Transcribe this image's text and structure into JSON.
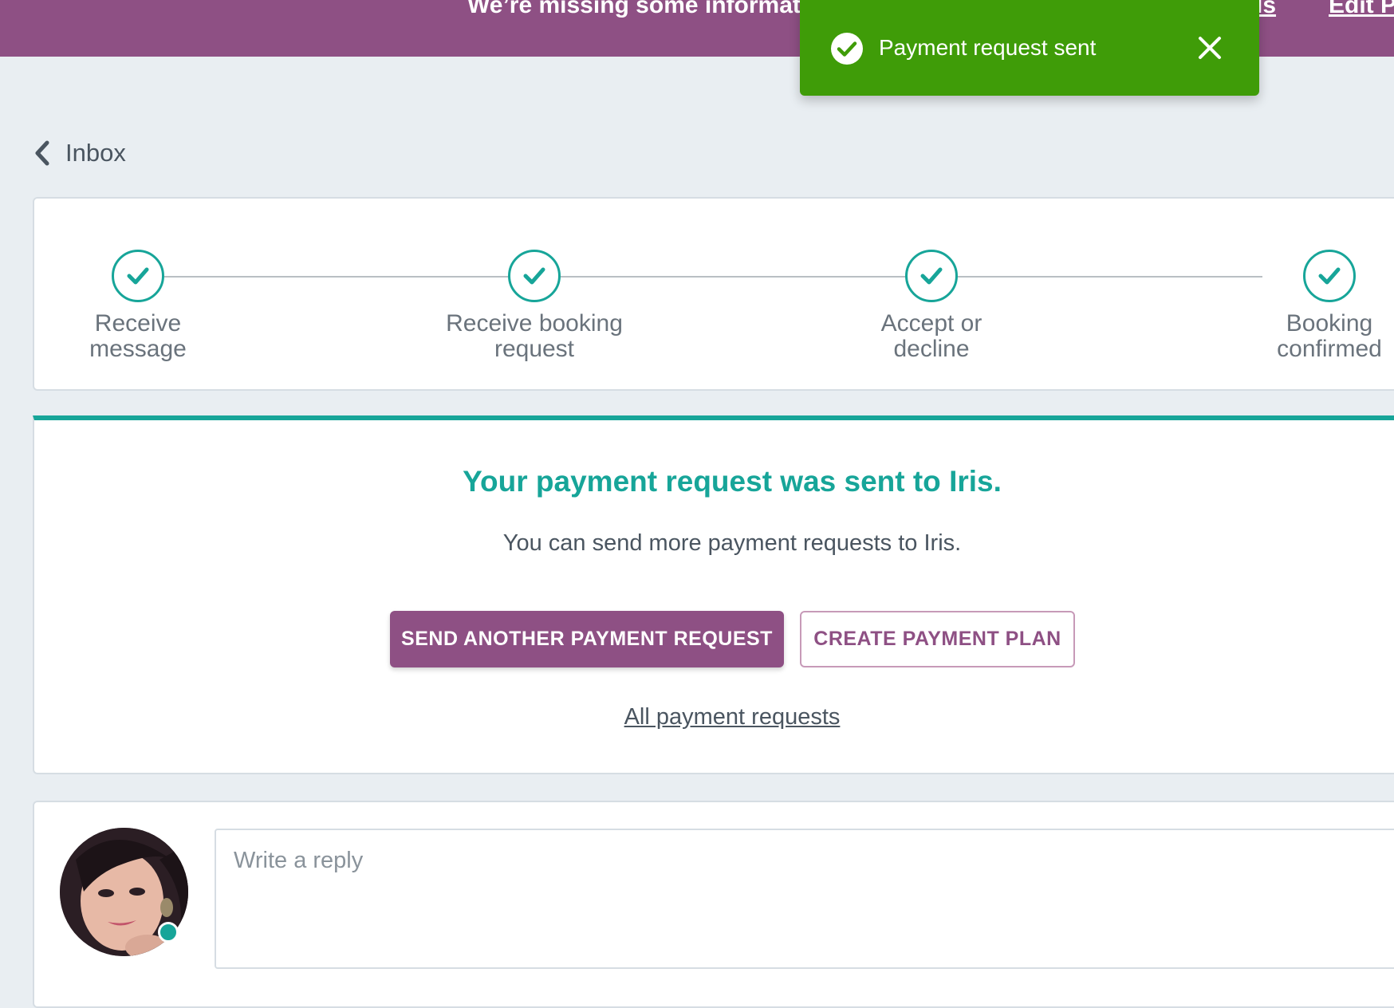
{
  "banner": {
    "text": "We’re missing some informatio",
    "link_details": "tails",
    "link_edit": "Edit P"
  },
  "toast": {
    "message": "Payment request sent",
    "icon": "check-circle-icon",
    "close_icon": "close-icon",
    "color": "#3f9c08"
  },
  "nav": {
    "back_label": "Inbox",
    "back_icon": "chevron-left-icon"
  },
  "progress": {
    "steps": [
      {
        "label": "Receive\nmessage",
        "status": "complete"
      },
      {
        "label": "Receive booking\nrequest",
        "status": "complete"
      },
      {
        "label": "Accept or\ndecline",
        "status": "complete"
      },
      {
        "label": "Booking\nconfirmed",
        "status": "complete"
      }
    ]
  },
  "result": {
    "title": "Your payment request was sent to Iris.",
    "subtitle": "You can send more payment requests to Iris.",
    "primary_button": "SEND ANOTHER PAYMENT REQUEST",
    "secondary_button": "CREATE PAYMENT PLAN",
    "all_link": "All payment requests"
  },
  "reply": {
    "placeholder": "Write a reply",
    "avatar_status": "online"
  },
  "colors": {
    "brand": "#8e5084",
    "accent": "#17a599",
    "success": "#3f9c08",
    "background": "#e9eef2"
  }
}
